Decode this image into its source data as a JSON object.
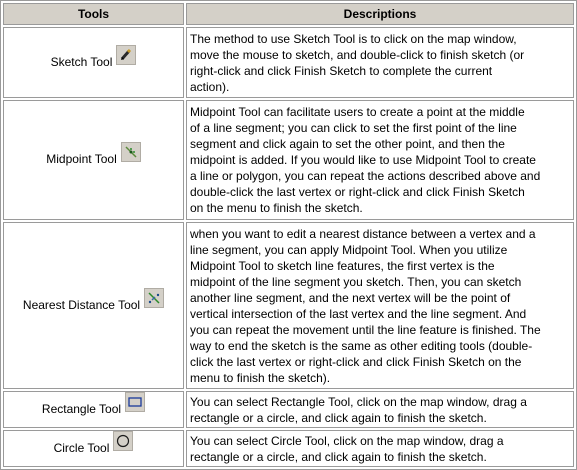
{
  "header": {
    "tools": "Tools",
    "descriptions": "Descriptions"
  },
  "rows": [
    {
      "tool": "Sketch Tool",
      "icon": "pencil-icon",
      "desc_lines": [
        "The method to use Sketch Tool is to click on the map window,",
        "move the mouse to sketch, and double-click to finish sketch (or",
        "right-click and click Finish Sketch to complete the current",
        "action)."
      ]
    },
    {
      "tool": "Midpoint Tool",
      "icon": "midpoint-icon",
      "desc_lines": [
        "Midpoint Tool can facilitate users to create a point at the middle",
        "of a line segment; you can click to set the first point of the line",
        "segment and click again to set the other point, and then the",
        "midpoint is added. If you would like to use Midpoint Tool to create",
        "a line or polygon, you can repeat the actions described above and",
        "double-click the last vertex or right-click and click Finish Sketch",
        "on the menu to finish the sketch."
      ]
    },
    {
      "tool": "Nearest Distance Tool",
      "icon": "nearest-distance-icon",
      "desc_lines": [
        "when you want to edit a nearest distance between a vertex and a",
        "line segment, you can apply Midpoint Tool. When you utilize",
        "Midpoint Tool to sketch line features, the first vertex is the",
        "midpoint of the line segment you sketch. Then, you can sketch",
        "another line segment, and the next vertex will be the point of",
        "vertical intersection of the last vertex and the line segment. And",
        "you can repeat the movement until the line feature is finished. The",
        "way to end the sketch is the same as other editing tools (double-",
        "click the last vertex or right-click and click Finish Sketch on the",
        "menu to finish the sketch)."
      ]
    },
    {
      "tool": "Rectangle Tool",
      "icon": "rectangle-icon",
      "desc_lines": [
        "You can select Rectangle Tool, click on the map window, drag a",
        "rectangle or a circle, and click again to finish the sketch."
      ]
    },
    {
      "tool": "Circle Tool",
      "icon": "circle-icon",
      "desc_lines": [
        "You can select Circle Tool, click on the map window, drag a",
        "rectangle or a circle, and click again to finish the sketch."
      ]
    }
  ]
}
